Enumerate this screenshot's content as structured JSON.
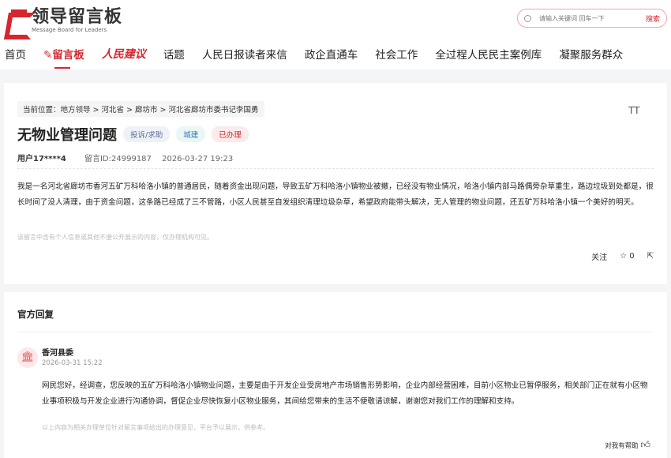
{
  "header": {
    "logo_title": "领导留言板",
    "logo_sub": "Message Board for Leaders",
    "search_placeholder": "请输入关键词 回车一下",
    "search_button": "搜索"
  },
  "nav": [
    "首页",
    "留言板",
    "人民建议",
    "话题",
    "人民日报读者来信",
    "政企直通车",
    "社会工作",
    "全过程人民民主案例库",
    "凝聚服务群众"
  ],
  "message": {
    "breadcrumb": "当前位置：地方领导 > 河北省 > 廊坊市 > 河北省廊坊市委书记李国勇",
    "font_toggle": "TT",
    "title": "无物业管理问题",
    "tags": [
      "投诉/求助",
      "城建",
      "已办理"
    ],
    "user": "用户17****4",
    "id": "留言ID:24999187",
    "time": "2026-03-27 19:23",
    "content": "我是一名河北省廊坊市香河五矿万科哈洛小镇的普通居民，随着资金出现问题，导致五矿万科哈洛小镇物业被撤，已经没有物业情况，哈洛小镇内部马路偶旁杂草重生，路边垃圾到处都是，很长时间了没人清理，由于资金问题，这条路已经成了三不管路，小区人民甚至自发组织清理垃圾杂草，希望政府能带头解决，无人管理的物业问题，还五矿万科哈洛小镇一个美好的明天。",
    "privacy_note": "该留言中含有个人信息或其他不便公开展示的内容，仅办理机构可见。",
    "follow": "关注",
    "likes": "0"
  },
  "reply": {
    "heading": "官方回复",
    "org": "香河县委",
    "time": "2026-03-31 15:22",
    "content": "网民您好，经调查，您反映的五矿万科哈洛小镇物业问题，主要是由于开发企业受房地产市场销售形势影响，企业内部经营困难，目前小区物业已暂停服务，相关部门正在就有小区物业事项积极与开发企业进行沟通协调，督促企业尽快恢复小区物业服务，其间给您带来的生活不便敬请谅解，谢谢您对我们工作的理解和支持。",
    "note": "以上内容为相关办理单位针对留言事项给出的办理意见，平台予以展示，供参考。",
    "helpful": "对我有帮助"
  }
}
